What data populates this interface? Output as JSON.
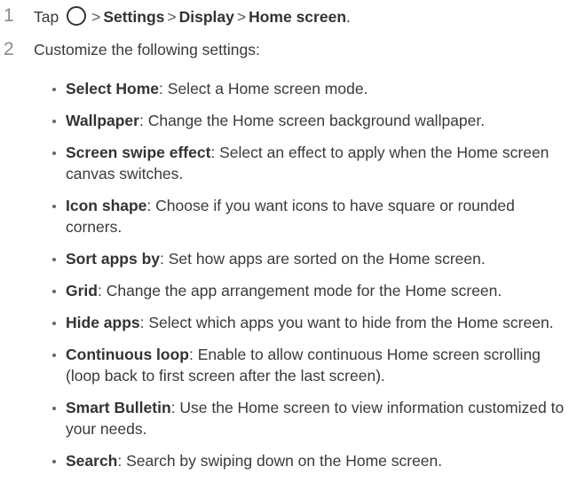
{
  "steps": [
    {
      "number": "1",
      "prefix": "Tap",
      "icon": "home-circle-icon",
      "path": [
        "Settings",
        "Display",
        "Home screen"
      ],
      "suffix": "."
    },
    {
      "number": "2",
      "text": "Customize the following settings:"
    }
  ],
  "settings": [
    {
      "name": "Select Home",
      "desc": ": Select a Home screen mode."
    },
    {
      "name": "Wallpaper",
      "desc": ": Change the Home screen background wallpaper."
    },
    {
      "name": "Screen swipe effect",
      "desc": ": Select an effect to apply when the Home screen canvas switches."
    },
    {
      "name": "Icon shape",
      "desc": ": Choose if you want icons to have square or rounded corners."
    },
    {
      "name": "Sort apps by",
      "desc": ": Set how apps are sorted on the Home screen."
    },
    {
      "name": "Grid",
      "desc": ": Change the app arrangement mode for the Home screen."
    },
    {
      "name": "Hide apps",
      "desc": ": Select which apps you want to hide from the Home screen."
    },
    {
      "name": "Continuous loop",
      "desc": ": Enable to allow continuous Home screen scrolling (loop back to first screen after the last screen)."
    },
    {
      "name": "Smart Bulletin",
      "desc": ": Use the Home screen to view information customized to your needs."
    },
    {
      "name": "Search",
      "desc": ": Search by swiping down on the Home screen."
    }
  ]
}
